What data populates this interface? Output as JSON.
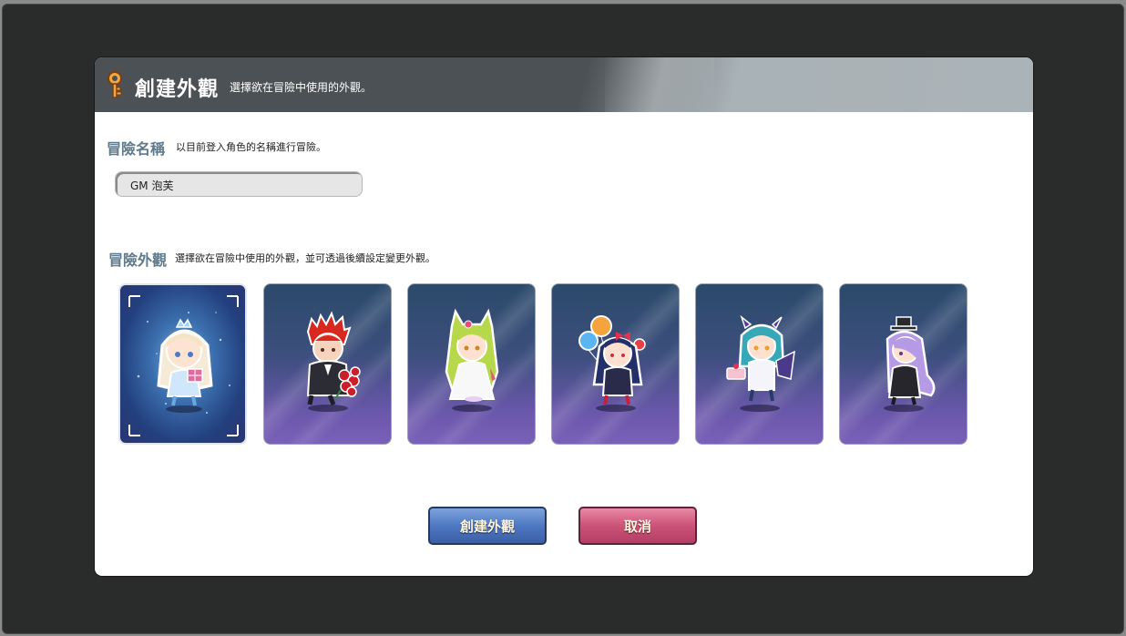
{
  "dialog": {
    "title": "創建外觀",
    "subtitle": "選擇欲在冒險中使用的外觀。"
  },
  "adventure_name": {
    "label": "冒險名稱",
    "description": "以目前登入角色的名稱進行冒險。",
    "value": "GM 泡芙"
  },
  "adventure_look": {
    "label": "冒險外觀",
    "description": "選擇欲在冒險中使用的外觀，並可透過後續設定變更外觀。",
    "selected_index": 0,
    "options": [
      {
        "name": "ice-princess-character",
        "selected": true
      },
      {
        "name": "red-hair-rose-character",
        "selected": false
      },
      {
        "name": "green-hair-cat-character",
        "selected": false
      },
      {
        "name": "balloon-girl-character",
        "selected": false
      },
      {
        "name": "teal-devil-cake-character",
        "selected": false
      },
      {
        "name": "purple-hair-top-hat-character",
        "selected": false
      }
    ]
  },
  "buttons": {
    "create_label": "創建外觀",
    "cancel_label": "取消"
  },
  "colors": {
    "create_button": "#4e78c2",
    "cancel_button": "#cc5278",
    "section_label": "#5d7a8c"
  }
}
